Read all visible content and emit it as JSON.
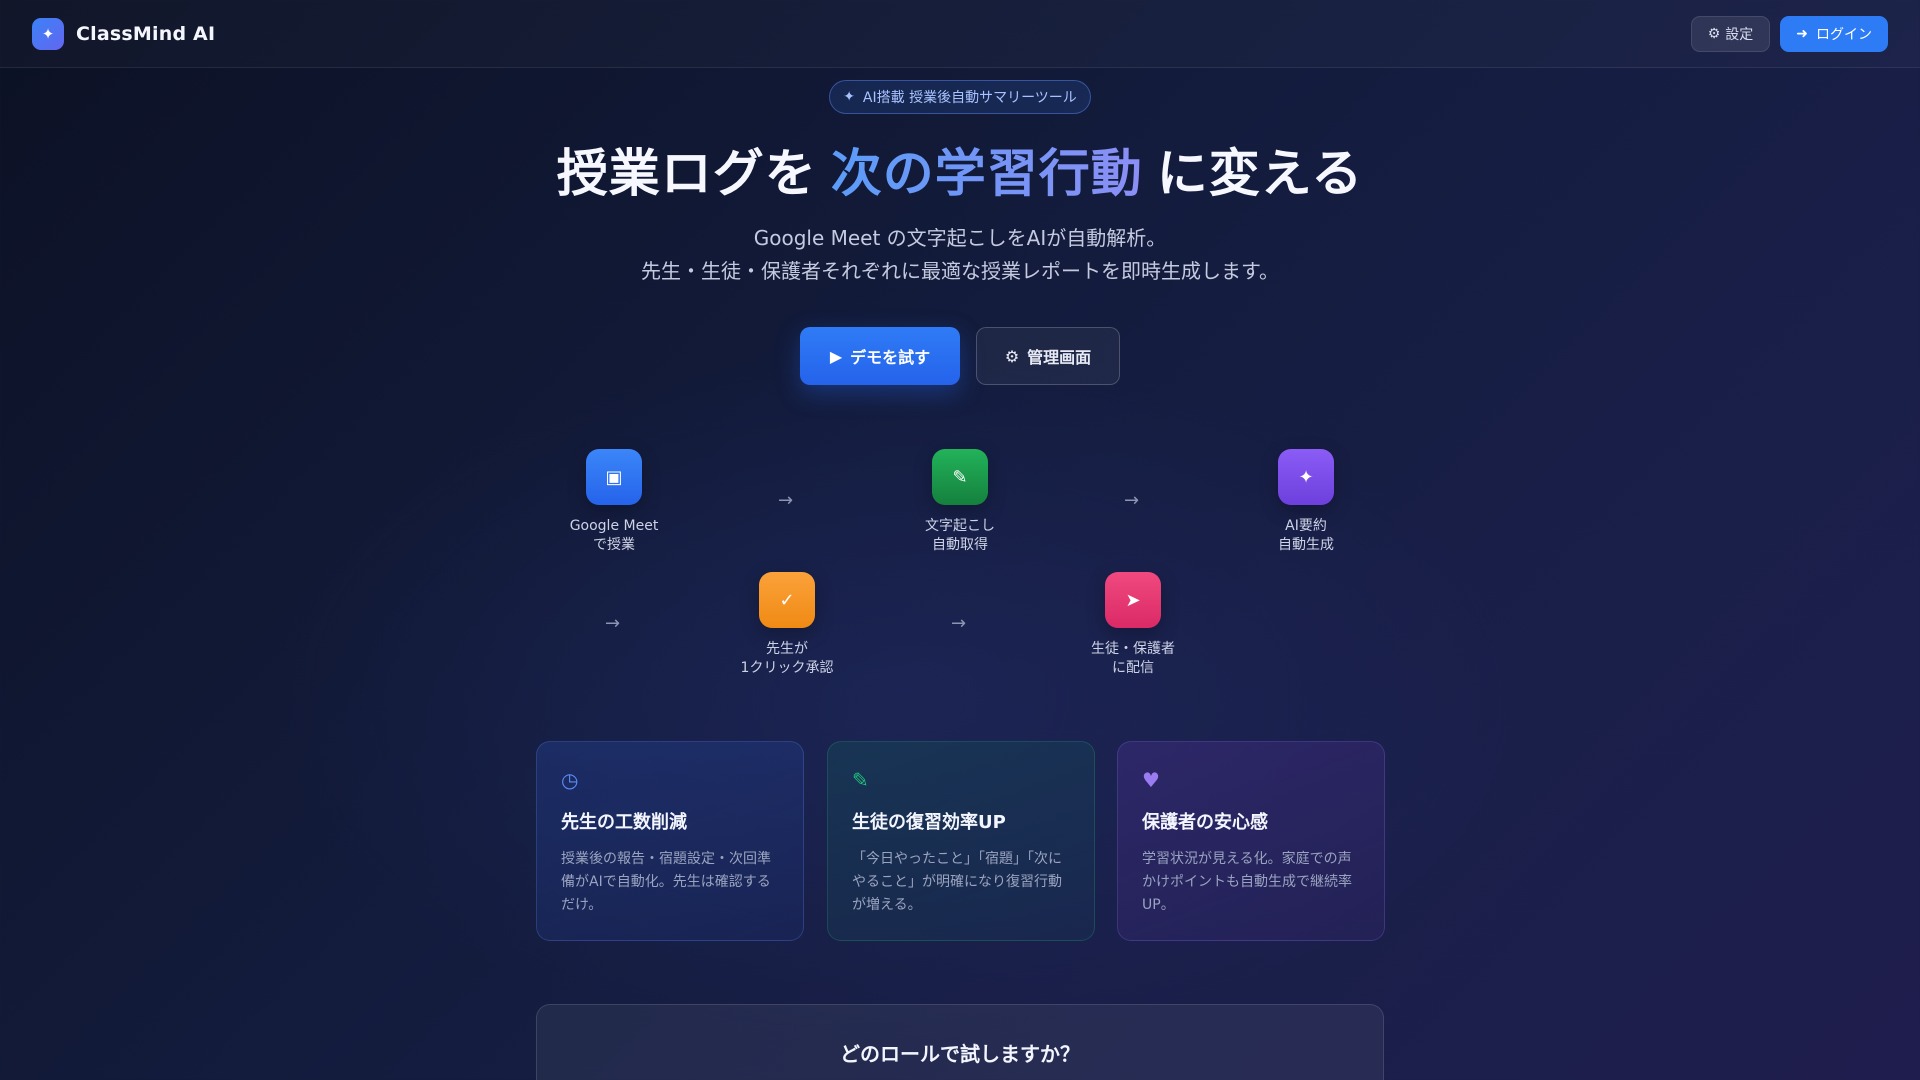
{
  "header": {
    "brand_icon": "✦",
    "brand_name": "ClassMind AI",
    "settings_icon": "⚙",
    "settings_label": "設定",
    "login_icon": "➜",
    "login_label": "ログイン"
  },
  "hero": {
    "badge_icon": "✦",
    "badge_text": "AI搭載 授業後自動サマリーツール",
    "title_before": "授業ログを",
    "title_accent": "次の学習行動",
    "title_after": "に変える",
    "subtitle_line1": "Google Meet の文字起こしをAIが自動解析。",
    "subtitle_line2": "先生・生徒・保護者それぞれに最適な授業レポートを即時生成します。",
    "demo_icon": "▶",
    "demo_label": "デモを試す",
    "admin_icon": "⚙",
    "admin_label": "管理画面"
  },
  "flow": {
    "arrow": "→",
    "steps": [
      {
        "icon": "▣",
        "line1": "Google Meet",
        "line2": "で授業",
        "color": "#2f7bf6"
      },
      {
        "icon": "✎",
        "line1": "文字起こし",
        "line2": "自動取得",
        "color": "#16a34a"
      },
      {
        "icon": "✦",
        "line1": "AI要約",
        "line2": "自動生成",
        "color": "#7c4dea"
      },
      {
        "icon": "✓",
        "line1": "先生が",
        "line2": "1クリック承認",
        "color": "#f59420"
      },
      {
        "icon": "➤",
        "line1": "生徒・保護者",
        "line2": "に配信",
        "color": "#e83c74"
      }
    ]
  },
  "features": [
    {
      "icon": "◷",
      "icon_color": "#5b8df5",
      "title": "先生の工数削減",
      "desc": "授業後の報告・宿題設定・次回準備がAIで自動化。先生は確認するだけ。"
    },
    {
      "icon": "✎",
      "icon_color": "#22c07a",
      "title": "生徒の復習効率UP",
      "desc": "「今日やったこと」「宿題」「次にやること」が明確になり復習行動が増える。"
    },
    {
      "icon": "♥",
      "icon_color": "#9b7bf2",
      "title": "保護者の安心感",
      "desc": "学習状況が見える化。家庭での声かけポイントも自動生成で継続率UP。"
    }
  ],
  "roles": {
    "title": "どのロールで試しますか？"
  }
}
